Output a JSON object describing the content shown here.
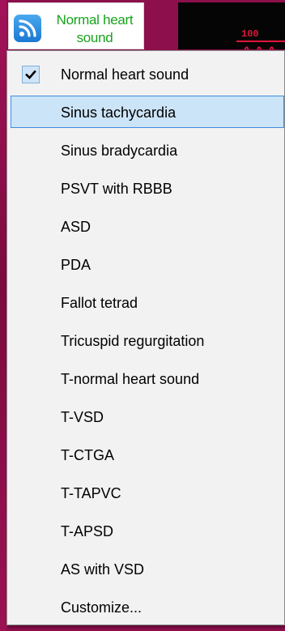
{
  "toolbar": {
    "sound_button_label": "Normal heart sound",
    "sound_button_icon": "rss-feed-icon"
  },
  "monitor": {
    "scale_value": "100"
  },
  "menu": {
    "items": [
      {
        "label": "Normal heart sound",
        "checked": true,
        "highlighted": false
      },
      {
        "label": "Sinus tachycardia",
        "checked": false,
        "highlighted": true
      },
      {
        "label": "Sinus bradycardia",
        "checked": false,
        "highlighted": false
      },
      {
        "label": "PSVT with RBBB",
        "checked": false,
        "highlighted": false
      },
      {
        "label": "ASD",
        "checked": false,
        "highlighted": false
      },
      {
        "label": "PDA",
        "checked": false,
        "highlighted": false
      },
      {
        "label": "Fallot tetrad",
        "checked": false,
        "highlighted": false
      },
      {
        "label": "Tricuspid regurgitation",
        "checked": false,
        "highlighted": false
      },
      {
        "label": "T-normal heart sound",
        "checked": false,
        "highlighted": false
      },
      {
        "label": "T-VSD",
        "checked": false,
        "highlighted": false
      },
      {
        "label": "T-CTGA",
        "checked": false,
        "highlighted": false
      },
      {
        "label": "T-TAPVC",
        "checked": false,
        "highlighted": false
      },
      {
        "label": "T-APSD",
        "checked": false,
        "highlighted": false
      },
      {
        "label": "AS with VSD",
        "checked": false,
        "highlighted": false
      },
      {
        "label": "Customize...",
        "checked": false,
        "highlighted": false
      }
    ]
  },
  "colors": {
    "app_background": "#8e0f4c",
    "label_green": "#17a31c",
    "monitor_red": "#e0173b",
    "highlight_fill": "#cce4f7",
    "highlight_border": "#3d8ee0"
  }
}
